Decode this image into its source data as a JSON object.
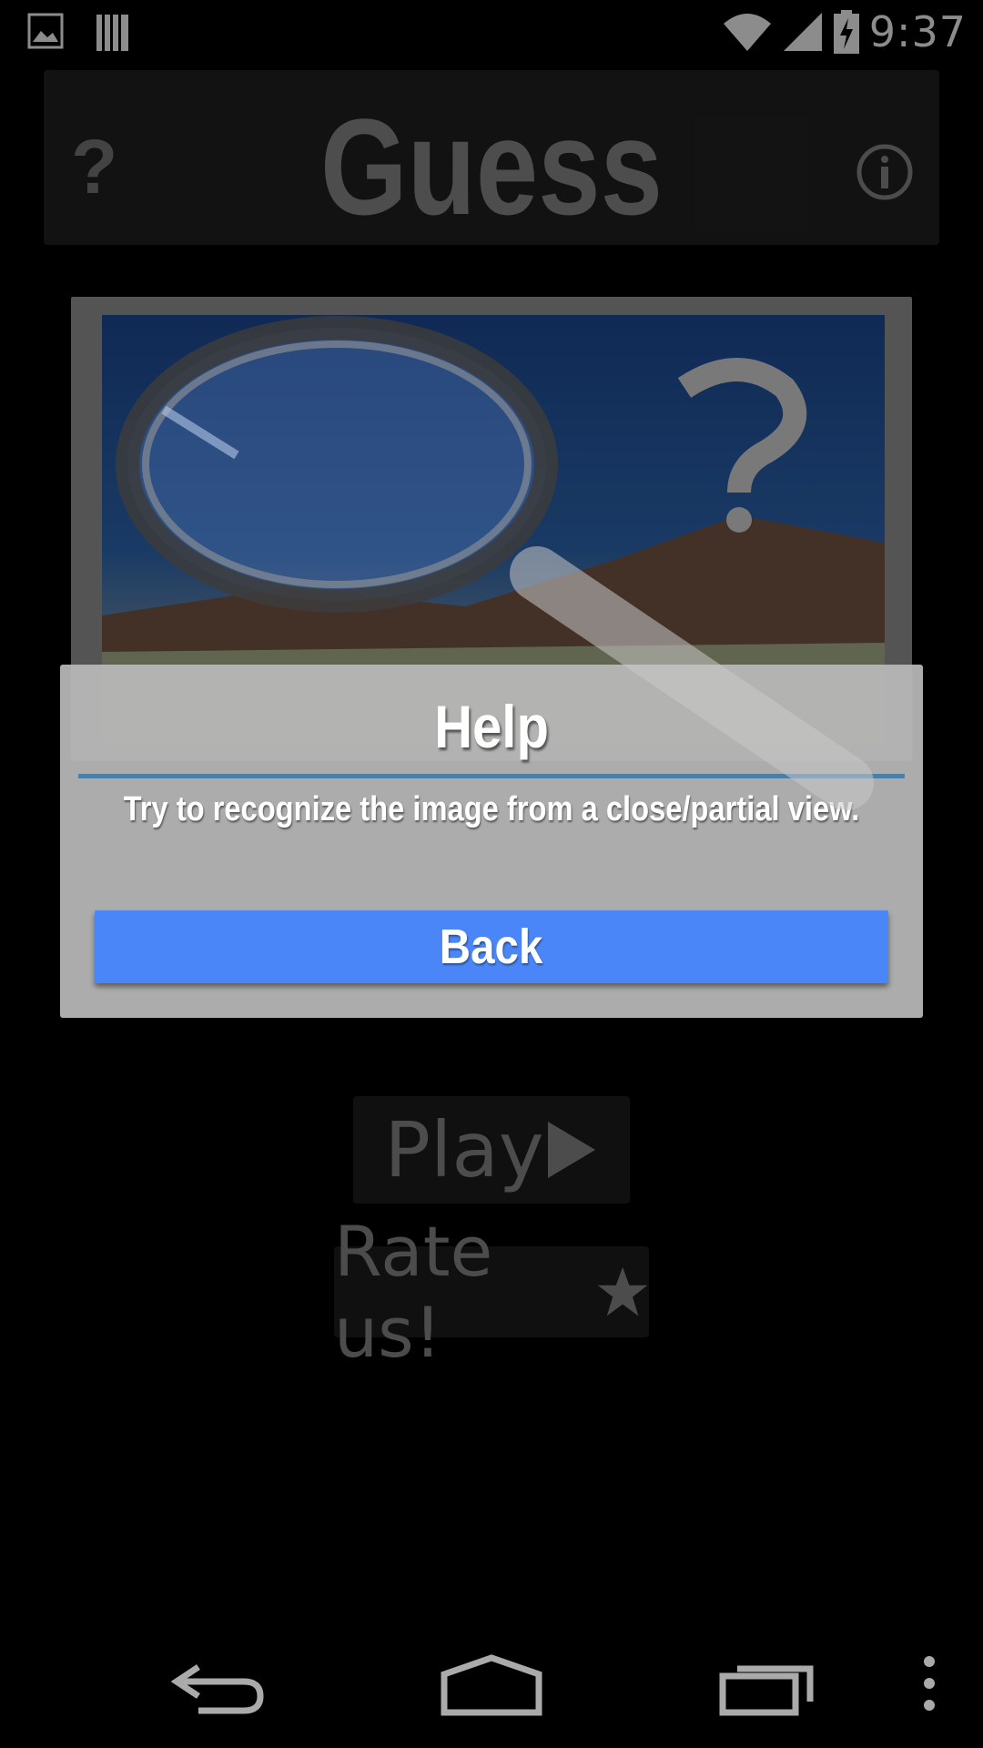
{
  "status_bar": {
    "time": "9:37",
    "icons": [
      "image-icon",
      "barcode-icon",
      "wifi-icon",
      "signal-icon",
      "battery-charging-icon"
    ]
  },
  "app": {
    "title": "Guess",
    "help_symbol": "?",
    "play_label": "Play",
    "rate_label": "Rate us!"
  },
  "dialog": {
    "title": "Help",
    "message": "Try to recognize the image from a close/partial view.",
    "back_label": "Back"
  },
  "colors": {
    "dialog_button": "#4a86f7",
    "divider": "#4a7fa8"
  },
  "nav_bar": {
    "icons": [
      "back-icon",
      "home-icon",
      "recents-icon",
      "menu-icon"
    ]
  }
}
